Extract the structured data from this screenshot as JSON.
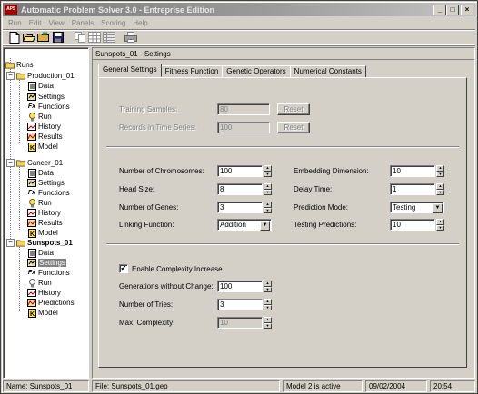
{
  "window": {
    "title": "Automatic Problem Solver 3.0 - Entreprise Edition",
    "app_icon_text": "APS",
    "minimize": "_",
    "maximize": "□",
    "close": "×"
  },
  "menu": [
    "Run",
    "Edit",
    "View",
    "Panels",
    "Scoring",
    "Help"
  ],
  "toolbar": {
    "buttons": [
      "new-icon",
      "open-icon",
      "open-folder-icon",
      "save-icon",
      "copy-icon",
      "grid-icon",
      "table-icon",
      "print-icon"
    ]
  },
  "tree": {
    "root": "Runs",
    "runs": [
      {
        "name": "Production_01",
        "items": [
          "Data",
          "Settings",
          "Functions",
          "Run",
          "History",
          "Results",
          "Model"
        ]
      },
      {
        "name": "Cancer_01",
        "items": [
          "Data",
          "Settings",
          "Functions",
          "Run",
          "History",
          "Results",
          "Model"
        ]
      },
      {
        "name": "Sunspots_01",
        "items": [
          "Data",
          "Settings",
          "Functions",
          "Run",
          "History",
          "Predictions",
          "Model"
        ]
      }
    ],
    "selected": "Sunspots_01 / Settings"
  },
  "doc": {
    "title": "Sunspots_01 - Settings",
    "tabs": [
      "General Settings",
      "Fitness Function",
      "Genetic Operators",
      "Numerical Constants"
    ]
  },
  "general": {
    "training_samples_label": "Training Samples:",
    "training_samples_value": "80",
    "records_label": "Records in Time Series:",
    "records_value": "100",
    "reset_label": "Reset",
    "chromosomes_label": "Number of Chromosomes:",
    "chromosomes_value": "100",
    "head_size_label": "Head Size:",
    "head_size_value": "8",
    "genes_label": "Number of Genes:",
    "genes_value": "3",
    "linking_label": "Linking Function:",
    "linking_value": "Addition",
    "embedding_label": "Embedding Dimension:",
    "embedding_value": "10",
    "delay_label": "Delay Time:",
    "delay_value": "1",
    "prediction_mode_label": "Prediction Mode:",
    "prediction_mode_value": "Testing",
    "testing_predictions_label": "Testing Predictions:",
    "testing_predictions_value": "10",
    "complexity_label": "Enable Complexity Increase",
    "complexity_checked": "✔",
    "generations_label": "Generations without Change:",
    "generations_value": "100",
    "tries_label": "Number of Tries:",
    "tries_value": "3",
    "max_complexity_label": "Max. Complexity:",
    "max_complexity_value": "10",
    "spin_up": "▲",
    "spin_down": "▼",
    "combo_arrow": "▼"
  },
  "status": {
    "name": "Name: Sunspots_01",
    "file": "File: Sunspots_01.gep",
    "model": "Model 2 is active",
    "date": "09/02/2004",
    "time": "20:54"
  }
}
